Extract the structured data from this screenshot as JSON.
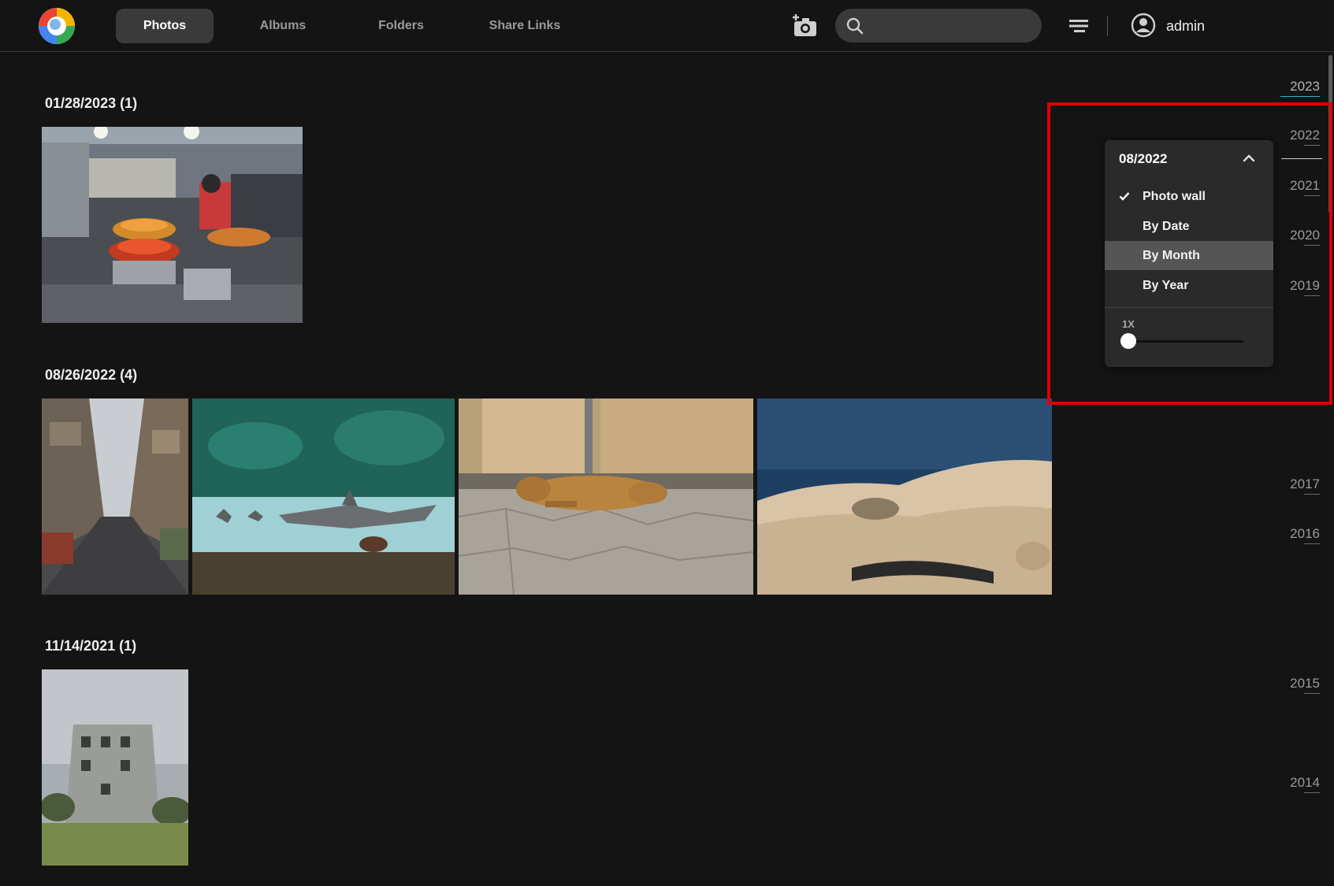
{
  "nav": {
    "tabs": [
      {
        "label": "Photos",
        "active": true
      },
      {
        "label": "Albums",
        "active": false
      },
      {
        "label": "Folders",
        "active": false
      },
      {
        "label": "Share Links",
        "active": false
      }
    ]
  },
  "search": {
    "placeholder": "",
    "value": ""
  },
  "user": {
    "name": "admin"
  },
  "groups": [
    {
      "title": "01/28/2023 (1)",
      "photos": [
        "market-stall"
      ]
    },
    {
      "title": "08/26/2022 (4)",
      "photos": [
        "street-alley",
        "aquarium-shark",
        "sleeping-dog",
        "coastal-rocks"
      ]
    },
    {
      "title": "11/14/2021 (1)",
      "photos": [
        "abandoned-building"
      ]
    }
  ],
  "timeline": {
    "years": [
      "2023",
      "2022",
      "2021",
      "2020",
      "2019",
      "2017",
      "2016",
      "2015",
      "2014"
    ],
    "current": "2023"
  },
  "view_menu": {
    "heading": "08/2022",
    "items": [
      {
        "label": "Photo wall",
        "checked": true
      },
      {
        "label": "By Date",
        "checked": false
      },
      {
        "label": "By Month",
        "checked": false,
        "hovered": true
      },
      {
        "label": "By Year",
        "checked": false
      }
    ],
    "zoom_label": "1X",
    "zoom_level": 0
  },
  "colors": {
    "background": "#141414",
    "accent": "#3fa7d6",
    "highlight": "#e00000"
  },
  "icons": [
    "logo-icon",
    "add-photo-icon",
    "search-icon",
    "filter-icon",
    "user-icon",
    "chevron-up-icon",
    "check-icon"
  ]
}
